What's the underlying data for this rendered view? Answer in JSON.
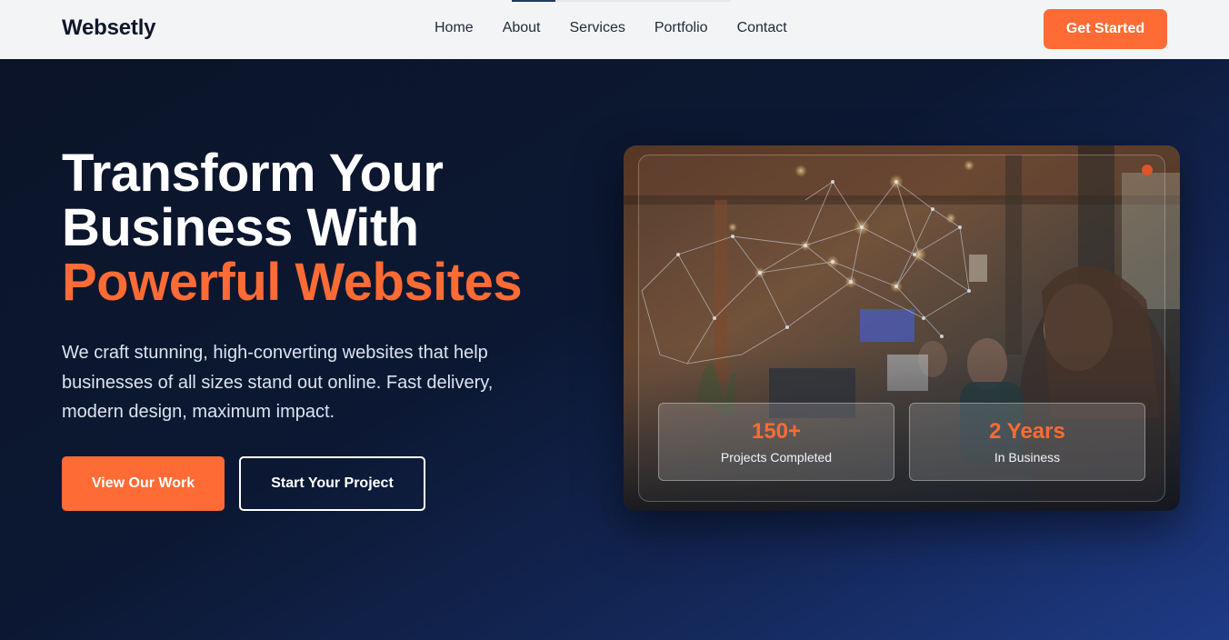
{
  "nav": {
    "brand": "Websetly",
    "links": [
      "Home",
      "About",
      "Services",
      "Portfolio",
      "Contact"
    ],
    "cta": "Get Started"
  },
  "hero": {
    "title_line1": "Transform Your",
    "title_line2": "Business With",
    "title_accent": "Powerful Websites",
    "lead": "We craft stunning, high-converting websites that help businesses of all sizes stand out online. Fast delivery, modern design, maximum impact.",
    "primary_cta": "View Our Work",
    "secondary_cta": "Start Your Project"
  },
  "stats": [
    {
      "value": "150+",
      "label": "Projects Completed"
    },
    {
      "value": "2 Years",
      "label": "In Business"
    }
  ],
  "colors": {
    "accent": "#ff6b35",
    "navy": "#0b1730",
    "nav_bg": "#f3f4f6"
  }
}
